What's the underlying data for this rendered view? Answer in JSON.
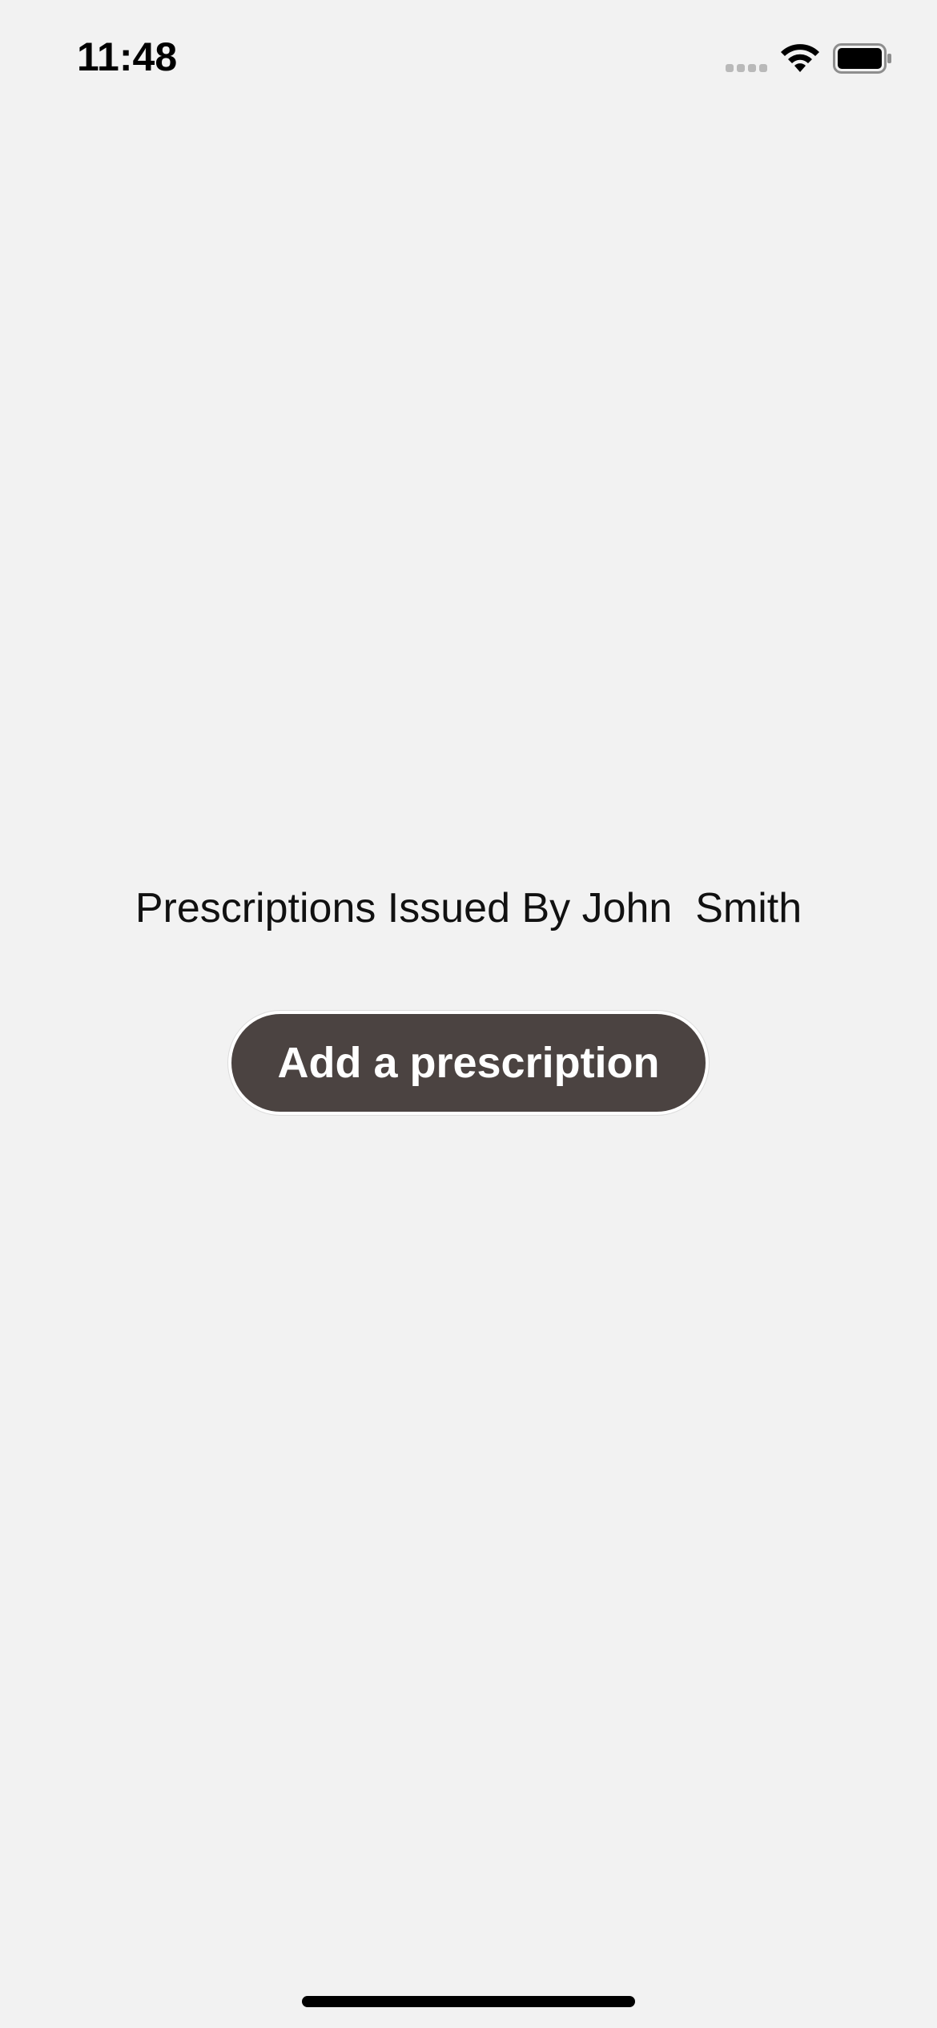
{
  "status_bar": {
    "time": "11:48",
    "icons": [
      "signal-icon",
      "wifi-icon",
      "battery-icon"
    ]
  },
  "main": {
    "title": "Prescriptions Issued By John  Smith",
    "add_button_label": "Add a prescription"
  },
  "colors": {
    "background": "#f2f2f2",
    "button": "#4b4341",
    "button_text": "#ffffff"
  }
}
